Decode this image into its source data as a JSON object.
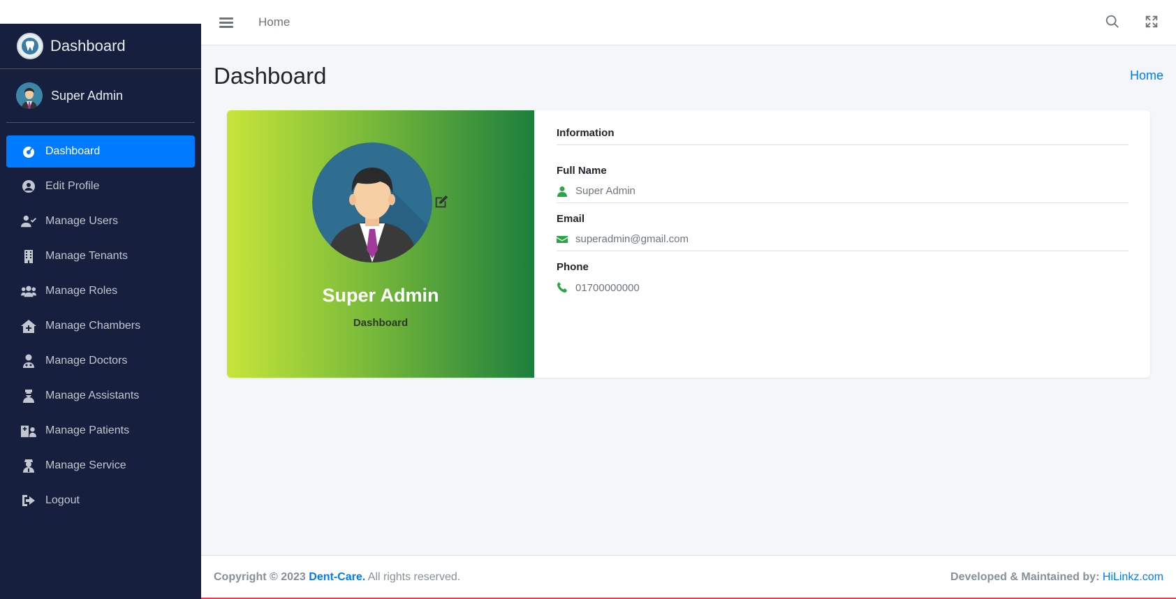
{
  "brand": {
    "title": "Dashboard",
    "logo_icon": "tooth-logo-icon"
  },
  "user": {
    "name": "Super Admin"
  },
  "sidebar": {
    "items": [
      {
        "label": "Dashboard",
        "icon": "dashboard-icon",
        "active": true
      },
      {
        "label": "Edit Profile",
        "icon": "user-circle-icon"
      },
      {
        "label": "Manage Users",
        "icon": "user-check-icon"
      },
      {
        "label": "Manage Tenants",
        "icon": "building-icon"
      },
      {
        "label": "Manage Roles",
        "icon": "users-icon"
      },
      {
        "label": "Manage Chambers",
        "icon": "clinic-icon"
      },
      {
        "label": "Manage Doctors",
        "icon": "doctor-icon"
      },
      {
        "label": "Manage Assistants",
        "icon": "nurse-icon"
      },
      {
        "label": "Manage Patients",
        "icon": "hospital-user-icon"
      },
      {
        "label": "Manage Service",
        "icon": "service-icon"
      },
      {
        "label": "Logout",
        "icon": "sign-out-icon"
      }
    ]
  },
  "topbar": {
    "home_link": "Home"
  },
  "content": {
    "page_title": "Dashboard",
    "breadcrumb": "Home"
  },
  "profile": {
    "name": "Super Admin",
    "role": "Dashboard",
    "info_title": "Information",
    "fields": {
      "full_name_label": "Full Name",
      "full_name_value": "Super Admin",
      "email_label": "Email",
      "email_value": "superadmin@gmail.com",
      "phone_label": "Phone",
      "phone_value": "01700000000"
    }
  },
  "footer": {
    "copyright_prefix": "Copyright © 2023",
    "brand_link": "Dent-Care.",
    "rights": "All rights reserved.",
    "dev_label": "Developed & Maintained by:",
    "dev_link": "HiLinkz.com"
  },
  "colors": {
    "sidebar_bg": "#161f3d",
    "active": "#007bff",
    "accent_green": "#28a745"
  }
}
